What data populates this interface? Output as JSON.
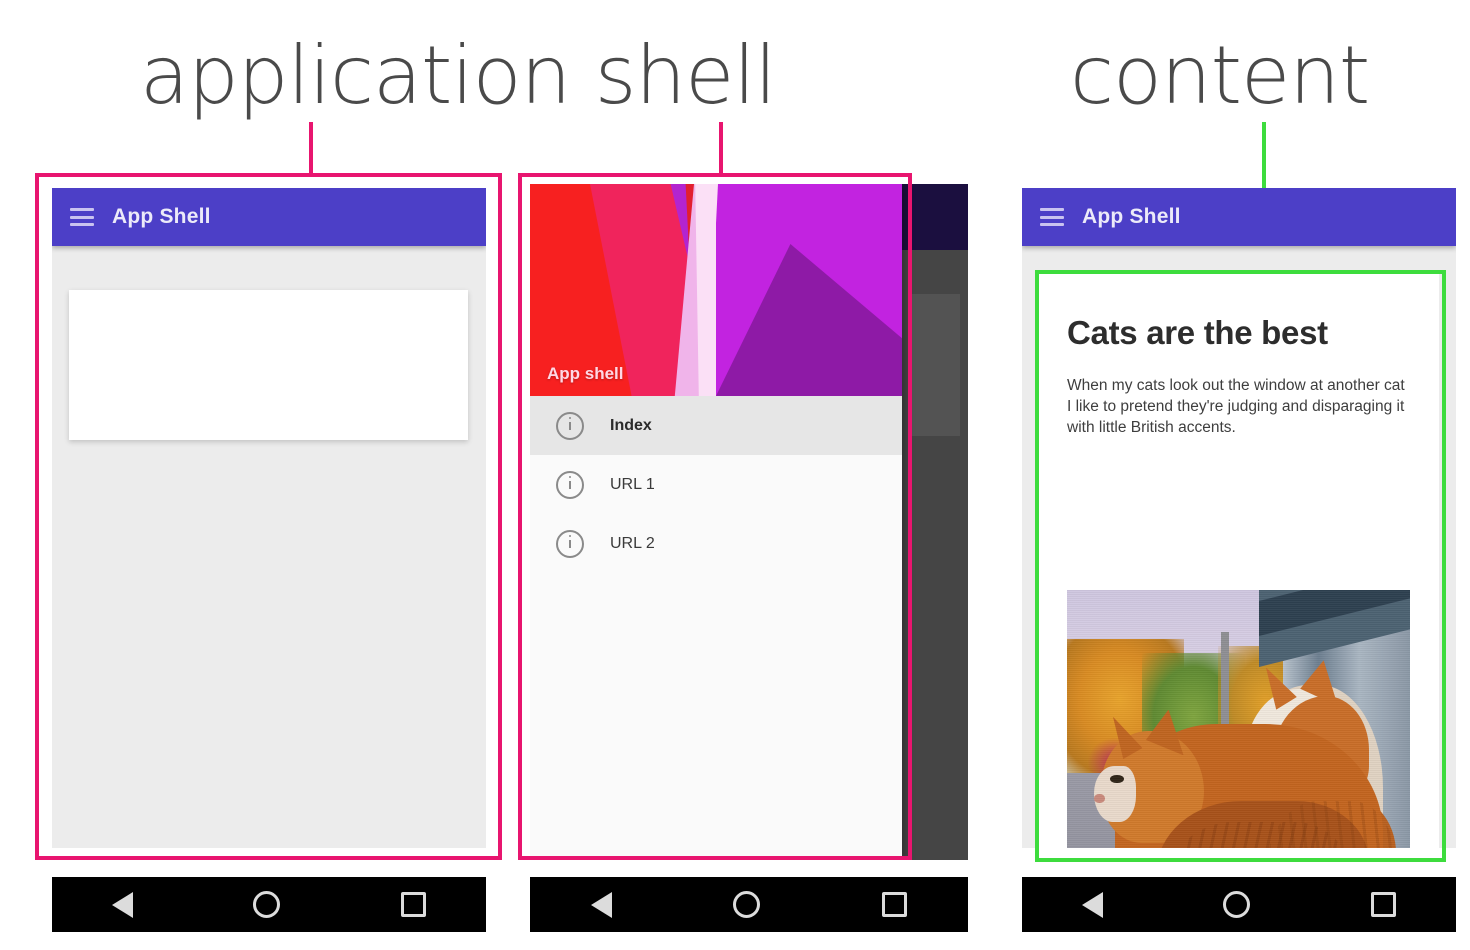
{
  "annotations": {
    "app_shell_label": "application shell",
    "content_label": "content",
    "accent_pink": "#e8156f",
    "accent_green": "#3ddc3d"
  },
  "colors": {
    "appbar_purple": "#4c3fc7",
    "surface_gray": "#ececec",
    "navbar_black": "#000000",
    "drawer_bg": "#fafafa",
    "active_item_bg": "#e6e6e6"
  },
  "phone1": {
    "appbar": {
      "title": "App Shell",
      "menu_icon": "hamburger-menu-icon"
    },
    "placeholder_card": ""
  },
  "phone2": {
    "drawer": {
      "header_title": "App shell",
      "items": [
        {
          "label": "Index",
          "icon": "info-circle-icon",
          "active": true
        },
        {
          "label": "URL 1",
          "icon": "info-circle-icon",
          "active": false
        },
        {
          "label": "URL 2",
          "icon": "info-circle-icon",
          "active": false
        }
      ]
    }
  },
  "phone3": {
    "appbar": {
      "title": "App Shell",
      "menu_icon": "hamburger-menu-icon"
    },
    "article": {
      "title": "Cats are the best",
      "body": "When my cats look out the window at another cat I like to pretend they're judging and disparaging it with little British accents.",
      "image_alt": "two ginger cats looking out a window"
    }
  },
  "navbar": {
    "back": "back-triangle-icon",
    "home": "home-circle-icon",
    "recent": "recents-square-icon"
  }
}
